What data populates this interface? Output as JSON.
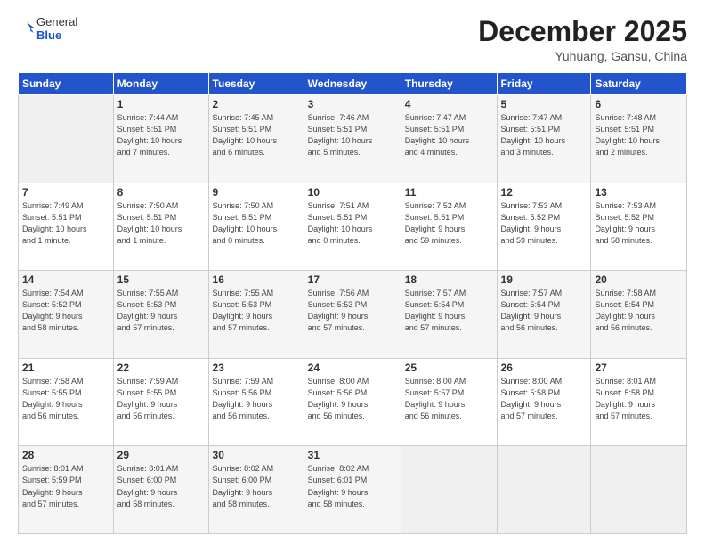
{
  "header": {
    "logo_line1": "General",
    "logo_line2": "Blue",
    "month_title": "December 2025",
    "location": "Yuhuang, Gansu, China"
  },
  "days_of_week": [
    "Sunday",
    "Monday",
    "Tuesday",
    "Wednesday",
    "Thursday",
    "Friday",
    "Saturday"
  ],
  "weeks": [
    [
      {
        "day": "",
        "info": ""
      },
      {
        "day": "1",
        "info": "Sunrise: 7:44 AM\nSunset: 5:51 PM\nDaylight: 10 hours\nand 7 minutes."
      },
      {
        "day": "2",
        "info": "Sunrise: 7:45 AM\nSunset: 5:51 PM\nDaylight: 10 hours\nand 6 minutes."
      },
      {
        "day": "3",
        "info": "Sunrise: 7:46 AM\nSunset: 5:51 PM\nDaylight: 10 hours\nand 5 minutes."
      },
      {
        "day": "4",
        "info": "Sunrise: 7:47 AM\nSunset: 5:51 PM\nDaylight: 10 hours\nand 4 minutes."
      },
      {
        "day": "5",
        "info": "Sunrise: 7:47 AM\nSunset: 5:51 PM\nDaylight: 10 hours\nand 3 minutes."
      },
      {
        "day": "6",
        "info": "Sunrise: 7:48 AM\nSunset: 5:51 PM\nDaylight: 10 hours\nand 2 minutes."
      }
    ],
    [
      {
        "day": "7",
        "info": "Sunrise: 7:49 AM\nSunset: 5:51 PM\nDaylight: 10 hours\nand 1 minute."
      },
      {
        "day": "8",
        "info": "Sunrise: 7:50 AM\nSunset: 5:51 PM\nDaylight: 10 hours\nand 1 minute."
      },
      {
        "day": "9",
        "info": "Sunrise: 7:50 AM\nSunset: 5:51 PM\nDaylight: 10 hours\nand 0 minutes."
      },
      {
        "day": "10",
        "info": "Sunrise: 7:51 AM\nSunset: 5:51 PM\nDaylight: 10 hours\nand 0 minutes."
      },
      {
        "day": "11",
        "info": "Sunrise: 7:52 AM\nSunset: 5:51 PM\nDaylight: 9 hours\nand 59 minutes."
      },
      {
        "day": "12",
        "info": "Sunrise: 7:53 AM\nSunset: 5:52 PM\nDaylight: 9 hours\nand 59 minutes."
      },
      {
        "day": "13",
        "info": "Sunrise: 7:53 AM\nSunset: 5:52 PM\nDaylight: 9 hours\nand 58 minutes."
      }
    ],
    [
      {
        "day": "14",
        "info": "Sunrise: 7:54 AM\nSunset: 5:52 PM\nDaylight: 9 hours\nand 58 minutes."
      },
      {
        "day": "15",
        "info": "Sunrise: 7:55 AM\nSunset: 5:53 PM\nDaylight: 9 hours\nand 57 minutes."
      },
      {
        "day": "16",
        "info": "Sunrise: 7:55 AM\nSunset: 5:53 PM\nDaylight: 9 hours\nand 57 minutes."
      },
      {
        "day": "17",
        "info": "Sunrise: 7:56 AM\nSunset: 5:53 PM\nDaylight: 9 hours\nand 57 minutes."
      },
      {
        "day": "18",
        "info": "Sunrise: 7:57 AM\nSunset: 5:54 PM\nDaylight: 9 hours\nand 57 minutes."
      },
      {
        "day": "19",
        "info": "Sunrise: 7:57 AM\nSunset: 5:54 PM\nDaylight: 9 hours\nand 56 minutes."
      },
      {
        "day": "20",
        "info": "Sunrise: 7:58 AM\nSunset: 5:54 PM\nDaylight: 9 hours\nand 56 minutes."
      }
    ],
    [
      {
        "day": "21",
        "info": "Sunrise: 7:58 AM\nSunset: 5:55 PM\nDaylight: 9 hours\nand 56 minutes."
      },
      {
        "day": "22",
        "info": "Sunrise: 7:59 AM\nSunset: 5:55 PM\nDaylight: 9 hours\nand 56 minutes."
      },
      {
        "day": "23",
        "info": "Sunrise: 7:59 AM\nSunset: 5:56 PM\nDaylight: 9 hours\nand 56 minutes."
      },
      {
        "day": "24",
        "info": "Sunrise: 8:00 AM\nSunset: 5:56 PM\nDaylight: 9 hours\nand 56 minutes."
      },
      {
        "day": "25",
        "info": "Sunrise: 8:00 AM\nSunset: 5:57 PM\nDaylight: 9 hours\nand 56 minutes."
      },
      {
        "day": "26",
        "info": "Sunrise: 8:00 AM\nSunset: 5:58 PM\nDaylight: 9 hours\nand 57 minutes."
      },
      {
        "day": "27",
        "info": "Sunrise: 8:01 AM\nSunset: 5:58 PM\nDaylight: 9 hours\nand 57 minutes."
      }
    ],
    [
      {
        "day": "28",
        "info": "Sunrise: 8:01 AM\nSunset: 5:59 PM\nDaylight: 9 hours\nand 57 minutes."
      },
      {
        "day": "29",
        "info": "Sunrise: 8:01 AM\nSunset: 6:00 PM\nDaylight: 9 hours\nand 58 minutes."
      },
      {
        "day": "30",
        "info": "Sunrise: 8:02 AM\nSunset: 6:00 PM\nDaylight: 9 hours\nand 58 minutes."
      },
      {
        "day": "31",
        "info": "Sunrise: 8:02 AM\nSunset: 6:01 PM\nDaylight: 9 hours\nand 58 minutes."
      },
      {
        "day": "",
        "info": ""
      },
      {
        "day": "",
        "info": ""
      },
      {
        "day": "",
        "info": ""
      }
    ]
  ]
}
